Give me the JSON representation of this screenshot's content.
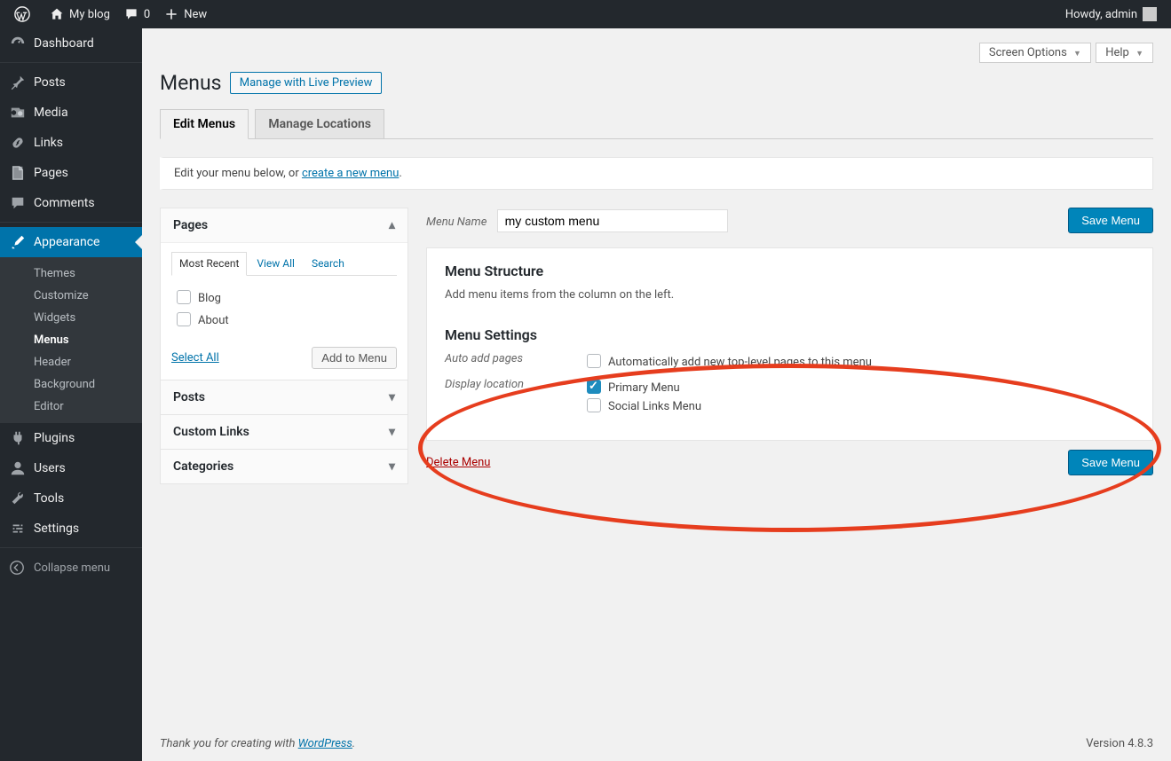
{
  "adminbar": {
    "site_name": "My blog",
    "comments_count": "0",
    "new_label": "New",
    "howdy": "Howdy, admin"
  },
  "sidebar": {
    "items": [
      {
        "label": "Dashboard",
        "icon": "dashboard"
      },
      {
        "label": "Posts",
        "icon": "pin"
      },
      {
        "label": "Media",
        "icon": "media"
      },
      {
        "label": "Links",
        "icon": "link"
      },
      {
        "label": "Pages",
        "icon": "page"
      },
      {
        "label": "Comments",
        "icon": "comment"
      },
      {
        "label": "Appearance",
        "icon": "brush",
        "current": true
      },
      {
        "label": "Plugins",
        "icon": "plug"
      },
      {
        "label": "Users",
        "icon": "user"
      },
      {
        "label": "Tools",
        "icon": "tool"
      },
      {
        "label": "Settings",
        "icon": "settings"
      }
    ],
    "appearance_sub": [
      "Themes",
      "Customize",
      "Widgets",
      "Menus",
      "Header",
      "Background",
      "Editor"
    ],
    "appearance_sub_current": "Menus",
    "collapse": "Collapse menu"
  },
  "top_buttons": {
    "screen_options": "Screen Options",
    "help": "Help"
  },
  "page": {
    "title": "Menus",
    "title_action": "Manage with Live Preview",
    "tabs": [
      "Edit Menus",
      "Manage Locations"
    ],
    "active_tab": "Edit Menus",
    "notice_pre": "Edit your menu below, or ",
    "notice_link": "create a new menu",
    "notice_post": "."
  },
  "left": {
    "pages": {
      "title": "Pages",
      "subtabs": [
        "Most Recent",
        "View All",
        "Search"
      ],
      "active_subtab": "Most Recent",
      "items": [
        "Blog",
        "About"
      ],
      "select_all": "Select All",
      "add_btn": "Add to Menu"
    },
    "posts": {
      "title": "Posts"
    },
    "custom_links": {
      "title": "Custom Links"
    },
    "categories": {
      "title": "Categories"
    }
  },
  "right": {
    "menu_name_label": "Menu Name",
    "menu_name_value": "my custom menu",
    "save_btn": "Save Menu",
    "structure_title": "Menu Structure",
    "structure_hint": "Add menu items from the column on the left.",
    "settings_title": "Menu Settings",
    "auto_add_label": "Auto add pages",
    "auto_add_opt": "Automatically add new top-level pages to this menu",
    "display_loc_label": "Display location",
    "display_loc_opts": [
      {
        "label": "Primary Menu",
        "checked": true
      },
      {
        "label": "Social Links Menu",
        "checked": false
      }
    ],
    "delete": "Delete Menu"
  },
  "footer": {
    "thanks_pre": "Thank you for creating with ",
    "thanks_link": "WordPress",
    "thanks_post": ".",
    "version": "Version 4.8.3"
  }
}
